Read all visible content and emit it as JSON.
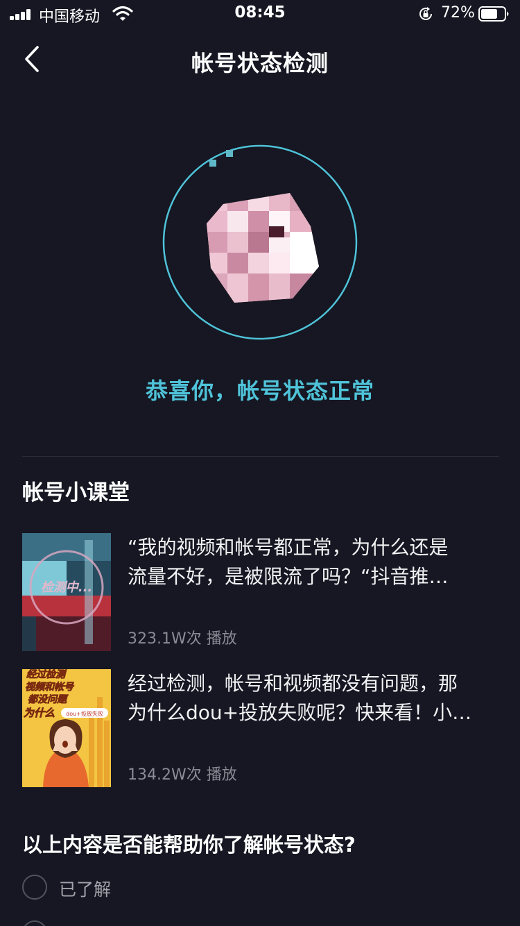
{
  "status_bar": {
    "carrier": "中国移动",
    "time": "08:45",
    "battery": "72%",
    "battery_level": 0.72
  },
  "nav": {
    "title": "帐号状态检测"
  },
  "result": {
    "message": "恭喜你，帐号状态正常"
  },
  "section": {
    "title": "帐号小课堂"
  },
  "videos": [
    {
      "line1": "“我的视频和帐号都正常，为什么还是",
      "line2": "流量不好，是被限流了吗？“抖音推…",
      "plays": "323.1W次 播放",
      "thumb_text": "检测中..."
    },
    {
      "line1": "经过检测，帐号和视频都没有问题，那",
      "line2": "为什么dou+投放失败呢？快来看！小…",
      "plays": "134.2W次 播放",
      "thumb_lines": [
        "经过检测",
        "视频和帐号",
        "都没问题",
        "为什么"
      ],
      "thumb_tag": "dou+投放失败"
    }
  ],
  "feedback": {
    "question": "以上内容是否能帮助你了解帐号状态?",
    "options": [
      "已了解"
    ]
  },
  "colors": {
    "background": "#161722",
    "accent": "#4fc3d9",
    "text_secondary": "#8a8b94"
  }
}
